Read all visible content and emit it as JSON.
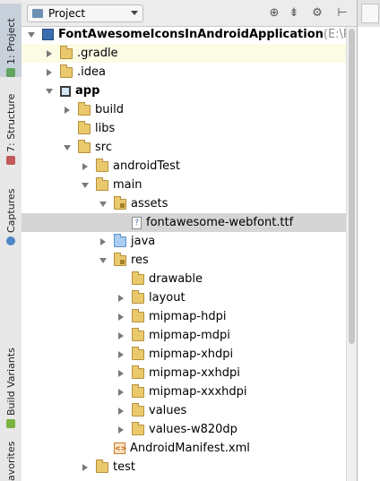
{
  "tool_strip": {
    "tabs": [
      {
        "label": "1: Project",
        "icon": "project-icon",
        "active": true
      },
      {
        "label": "7: Structure",
        "icon": "structure-icon",
        "active": false
      },
      {
        "label": "Captures",
        "icon": "captures-icon",
        "active": false
      },
      {
        "label": "Build Variants",
        "icon": "android-icon",
        "active": false
      },
      {
        "label": "avorites",
        "icon": "favorites-icon",
        "active": false
      }
    ]
  },
  "header": {
    "view_mode": "Project",
    "icons": [
      "sync-icon",
      "collapse-icon",
      "gear-icon",
      "hide-icon"
    ]
  },
  "tree": [
    {
      "label": "FontAwesomeIconsInAndroidApplication",
      "suffix": " (E:\\Pa",
      "icon": "project-module-icon",
      "indent": 0,
      "arrow": "d",
      "bold": true
    },
    {
      "label": ".gradle",
      "icon": "folder-icon",
      "indent": 1,
      "arrow": "r",
      "highlighted": true
    },
    {
      "label": ".idea",
      "icon": "folder-icon",
      "indent": 1,
      "arrow": "r"
    },
    {
      "label": "app",
      "icon": "module-icon",
      "indent": 1,
      "arrow": "d",
      "bold": true
    },
    {
      "label": "build",
      "icon": "folder-icon",
      "indent": 2,
      "arrow": "r"
    },
    {
      "label": "libs",
      "icon": "folder-icon",
      "indent": 2,
      "arrow": "n"
    },
    {
      "label": "src",
      "icon": "folder-icon",
      "indent": 2,
      "arrow": "d"
    },
    {
      "label": "androidTest",
      "icon": "folder-icon",
      "indent": 3,
      "arrow": "r"
    },
    {
      "label": "main",
      "icon": "folder-icon",
      "indent": 3,
      "arrow": "d"
    },
    {
      "label": "assets",
      "icon": "resource-folder-icon",
      "indent": 4,
      "arrow": "d"
    },
    {
      "label": "fontawesome-webfont.ttf",
      "icon": "unknown-file-icon",
      "indent": 5,
      "arrow": "n",
      "selected": true
    },
    {
      "label": "java",
      "icon": "source-folder-icon",
      "indent": 4,
      "arrow": "r"
    },
    {
      "label": "res",
      "icon": "resource-folder-icon",
      "indent": 4,
      "arrow": "d"
    },
    {
      "label": "drawable",
      "icon": "folder-icon",
      "indent": 5,
      "arrow": "n"
    },
    {
      "label": "layout",
      "icon": "folder-icon",
      "indent": 5,
      "arrow": "r"
    },
    {
      "label": "mipmap-hdpi",
      "icon": "folder-icon",
      "indent": 5,
      "arrow": "r"
    },
    {
      "label": "mipmap-mdpi",
      "icon": "folder-icon",
      "indent": 5,
      "arrow": "r"
    },
    {
      "label": "mipmap-xhdpi",
      "icon": "folder-icon",
      "indent": 5,
      "arrow": "r"
    },
    {
      "label": "mipmap-xxhdpi",
      "icon": "folder-icon",
      "indent": 5,
      "arrow": "r"
    },
    {
      "label": "mipmap-xxxhdpi",
      "icon": "folder-icon",
      "indent": 5,
      "arrow": "r"
    },
    {
      "label": "values",
      "icon": "folder-icon",
      "indent": 5,
      "arrow": "r"
    },
    {
      "label": "values-w820dp",
      "icon": "folder-icon",
      "indent": 5,
      "arrow": "r"
    },
    {
      "label": "AndroidManifest.xml",
      "icon": "xml-file-icon",
      "indent": 4,
      "arrow": "n"
    },
    {
      "label": "test",
      "icon": "folder-icon",
      "indent": 3,
      "arrow": "r"
    }
  ],
  "colors": {
    "selected_row": "#d5d5d5",
    "highlighted_row": "#fcfbe4",
    "folder": "#e9c96c",
    "source_folder": "#a9cdf3"
  }
}
